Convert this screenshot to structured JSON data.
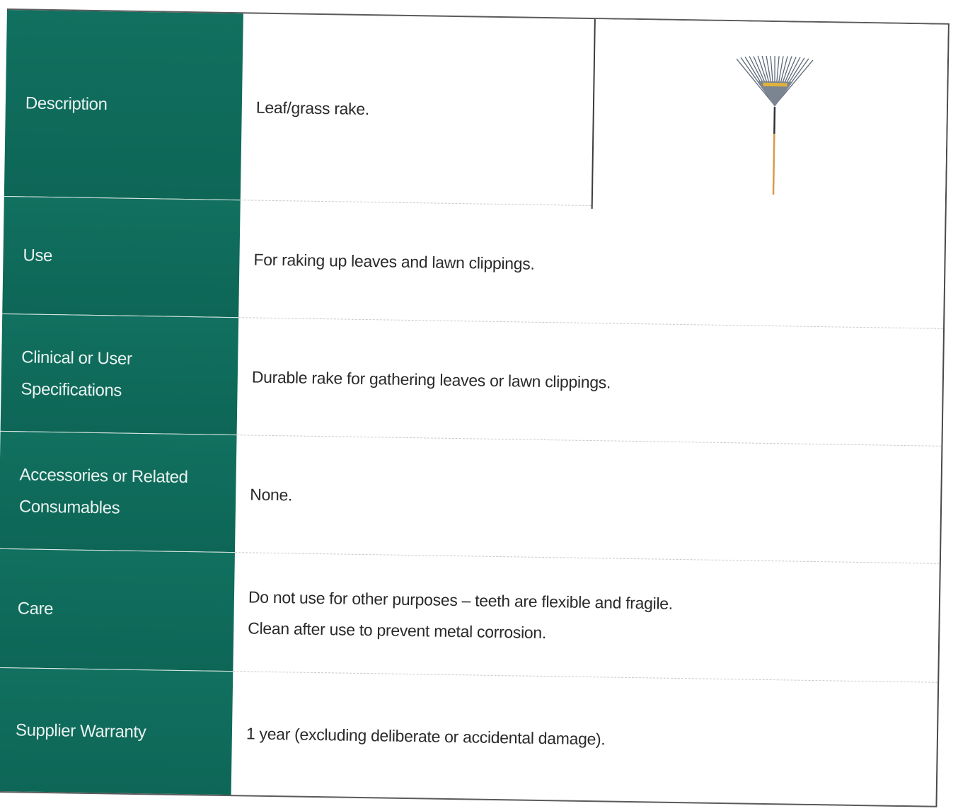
{
  "rows": [
    {
      "label": "Description",
      "value": "Leaf/grass rake."
    },
    {
      "label": "Use",
      "value": "For raking up leaves and lawn clippings."
    },
    {
      "label": "Clinical or User\nSpecifications",
      "value": "Durable rake for gathering leaves or lawn clippings."
    },
    {
      "label": "Accessories or Related\nConsumables",
      "value": "None."
    },
    {
      "label": "Care",
      "lines": [
        "Do not use for other purposes – teeth are flexible and fragile.",
        "Clean after use to prevent metal corrosion."
      ]
    },
    {
      "label": "Supplier Warranty",
      "value": "1 year (excluding deliberate or accidental damage)."
    }
  ],
  "colors": {
    "label_bg": "#0f6b5b",
    "label_text": "#e9f2ef",
    "value_text": "#2a2a2a"
  },
  "image": {
    "icon": "leaf-rake-icon"
  }
}
